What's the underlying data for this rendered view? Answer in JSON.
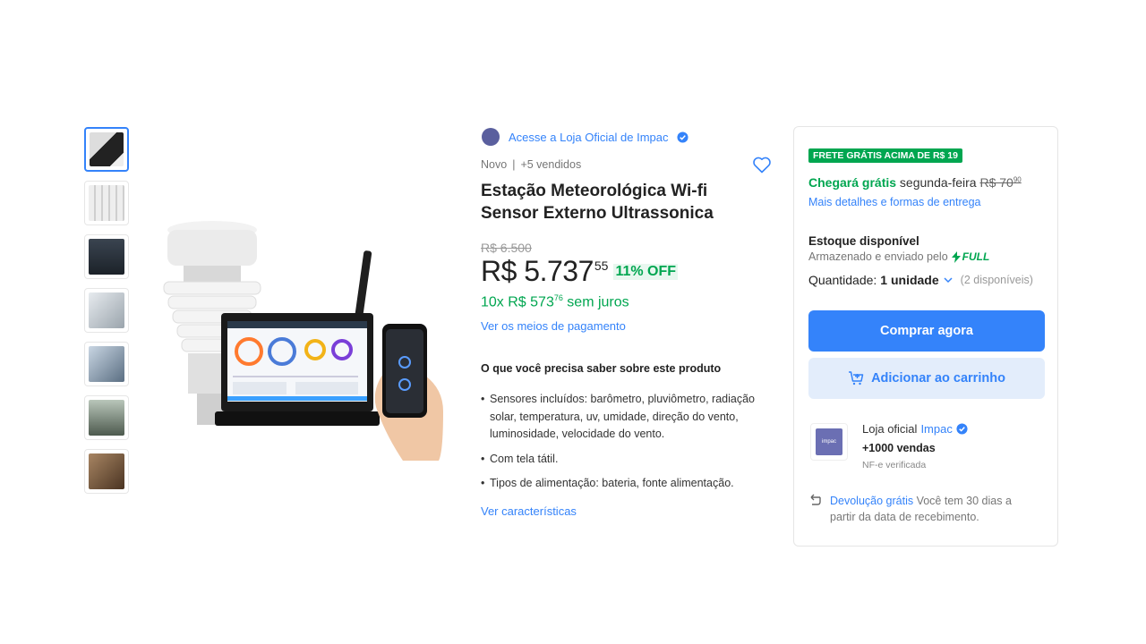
{
  "store": {
    "link_text": "Acesse a Loja Oficial de Impac"
  },
  "meta": {
    "condition": "Novo",
    "separator": "|",
    "sold": "+5 vendidos"
  },
  "product": {
    "title": "Estação Meteorológica Wi-fi Sensor Externo Ultrassonica",
    "original_price": "R$ 6.500",
    "price": "R$ 5.737",
    "price_cents": "55",
    "discount": "11% OFF",
    "installments_prefix": "10x R$ 573",
    "installments_cents": "76",
    "installments_suffix": " sem juros",
    "payment_link": "Ver os meios de pagamento"
  },
  "features": {
    "heading": "O que você precisa saber sobre este produto",
    "items": [
      "Sensores incluídos: barômetro, pluviômetro, radiação solar, temperatura, uv, umidade, direção do vento, luminosidade, velocidade do vento.",
      "Com tela tátil.",
      "Tipos de alimentação: bateria, fonte alimentação."
    ],
    "link": "Ver características"
  },
  "buybox": {
    "badge": "FRETE GRÁTIS ACIMA DE R$ 19",
    "ship_green": "Chegará grátis",
    "ship_day": " segunda-feira ",
    "ship_old": "R$ 70",
    "ship_old_cents": "90",
    "ship_link": "Mais detalhes e formas de entrega",
    "stock_title": "Estoque disponível",
    "stored_text": "Armazenado e enviado pelo",
    "full_label": "FULL",
    "qty_label": "Quantidade:",
    "qty_value": "1 unidade",
    "qty_available": "(2 disponíveis)",
    "buy_now": "Comprar agora",
    "add_cart": "Adicionar ao carrinho"
  },
  "seller": {
    "prefix": "Loja oficial",
    "name": "Impac",
    "sales": "+1000 vendas",
    "nf": "NF-e verificada",
    "logo_text": "impac"
  },
  "returns": {
    "link": "Devolução grátis",
    "text": " Você tem 30 dias a partir da data de recebimento."
  },
  "colors": {
    "accent": "#3483fa",
    "green": "#00a650"
  }
}
